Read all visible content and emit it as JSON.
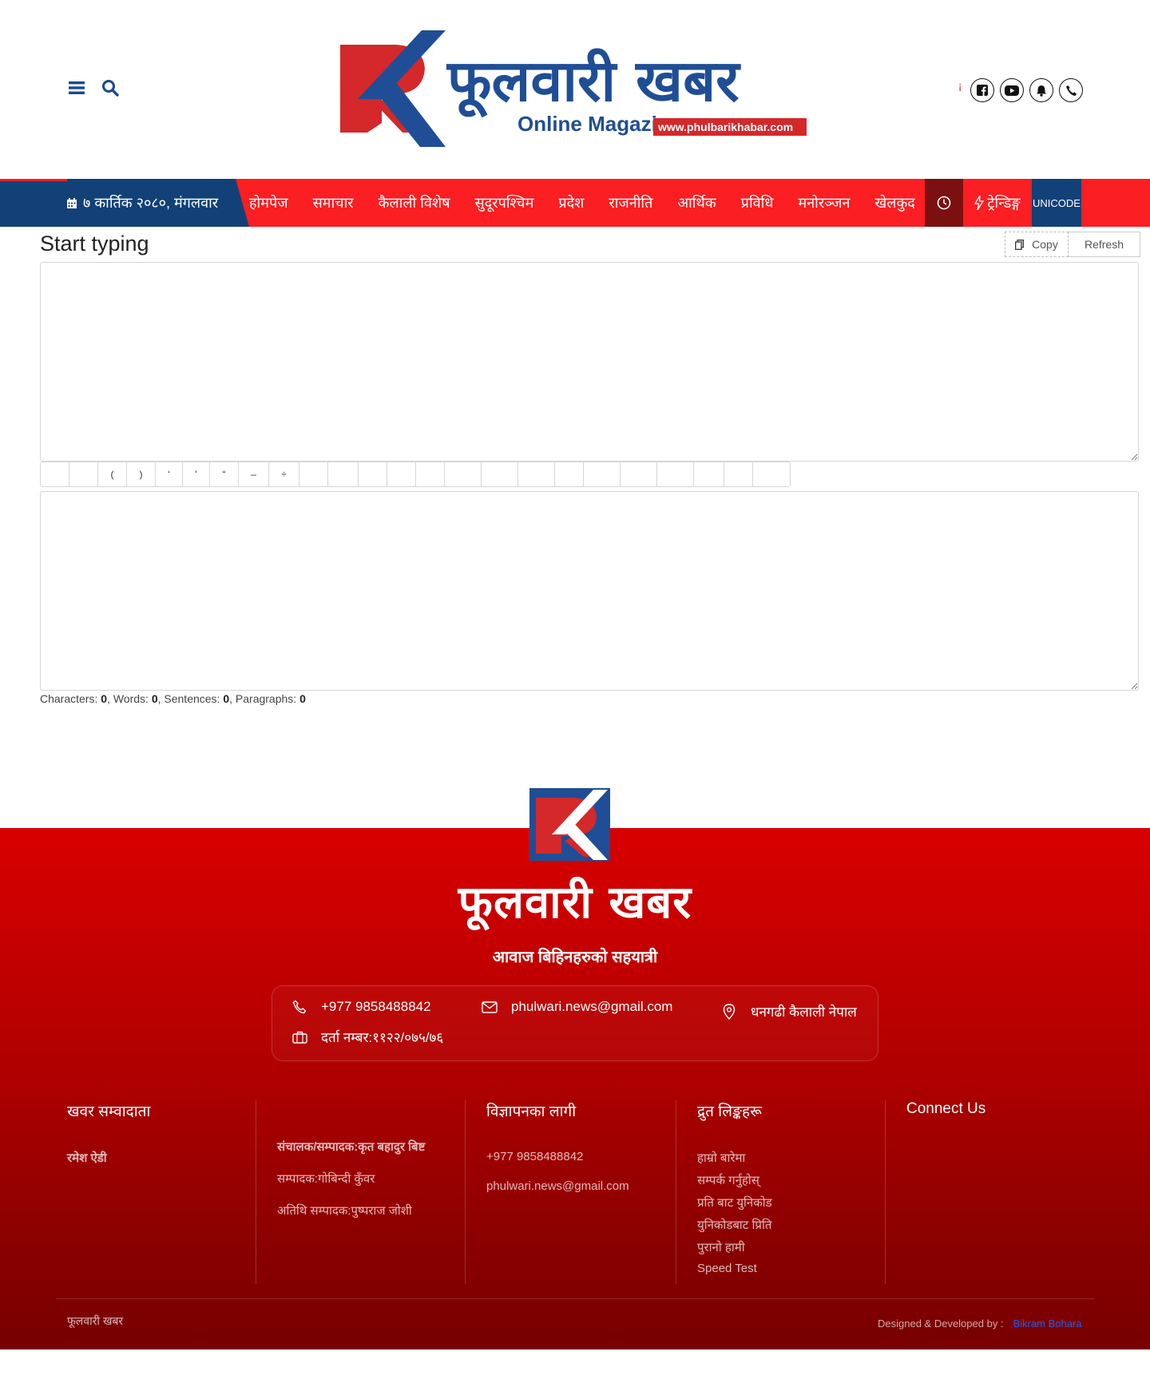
{
  "header": {
    "menu_icon": "bars-icon",
    "search_icon": "search-icon",
    "logo": {
      "title": "फूलवारी खबर",
      "subtitle": "Online Magazine",
      "url": "www.phulbarikhabar.com"
    },
    "social_icons": [
      "facebook-icon",
      "youtube-icon",
      "bell-icon",
      "phone-icon"
    ]
  },
  "nav": {
    "date": "७ कार्तिक २०८०, मंगलवार",
    "items": [
      "होमपेज",
      "समाचार",
      "कैलाली विशेष",
      "सुदूरपश्चिम",
      "प्रदेश",
      "राजनीति",
      "आर्थिक",
      "प्रविधि",
      "मनोरञ्जन",
      "खेलकुद"
    ],
    "trending": "ट्रेन्डिङ्ग",
    "unicode": "UNICODE"
  },
  "editor": {
    "title": "Start typing",
    "copy_label": "Copy",
    "refresh_label": "Refresh",
    "input_value": "",
    "output_value": "",
    "chars": [
      "",
      "",
      "(",
      ")",
      "‘",
      "'",
      "“",
      "–",
      "÷",
      "",
      "",
      "",
      "",
      "",
      "",
      "",
      "",
      "",
      "",
      "",
      "",
      "",
      "",
      ""
    ],
    "stats": {
      "characters_label": "Characters:",
      "characters": "0",
      "words_label": ", Words:",
      "words": "0",
      "sentences_label": ", Sentences:",
      "sentences": "0",
      "paragraphs_label": ", Paragraphs:",
      "paragraphs": "0"
    }
  },
  "footer": {
    "brand": "फूलवारी खबर",
    "tagline": "आवाज बिहिनहरुको सहयात्री",
    "contact": {
      "phone": "+977 9858488842",
      "email": "phulwari.news@gmail.com",
      "address": "धनगढी कैलाली नेपाल",
      "registration": "दर्ता नम्बर:११२२/०७५/७६"
    },
    "columns": {
      "reporters": {
        "heading": "खवर सम्वादाता",
        "items": [
          "रमेश ऐडी"
        ]
      },
      "editors": {
        "items": [
          "संचालक/सम्पादक:कृत बहादुर बिष्ट",
          "सम्पादक:गोबिन्दी कुँवर",
          "अतिथि सम्पादक:पुष्पराज जोशी"
        ]
      },
      "ads": {
        "heading": "विज्ञापनका लागी",
        "items": [
          "+977 9858488842",
          "phulwari.news@gmail.com"
        ]
      },
      "quick_links": {
        "heading": "द्रुत लिङ्कहरू",
        "items": [
          "हाम्रो बारेमा",
          "सम्पर्क गर्नुहोस्",
          "प्रति बाट युनिकोड",
          "युनिकोडबाट प्रिति",
          "पुरानो हामी",
          "Speed Test"
        ]
      },
      "connect": {
        "heading": "Connect Us"
      }
    },
    "copyright": "फूलवारी खबर",
    "credit_label": "Designed & Developed by :",
    "credit_name": "Bikram Bohara"
  },
  "colors": {
    "brand_red": "#fb1e22",
    "brand_blue": "#124177",
    "dark_red": "#7c1010"
  }
}
